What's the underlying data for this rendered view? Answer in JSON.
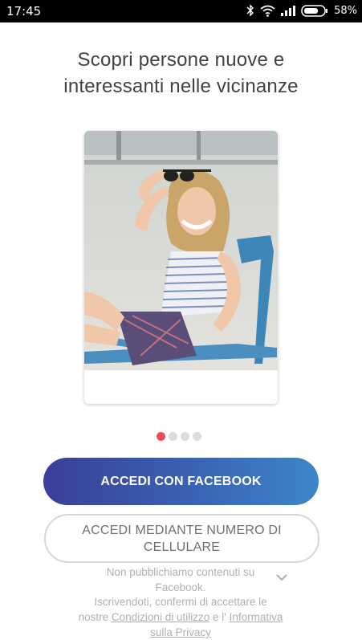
{
  "status_bar": {
    "time": "17:45",
    "battery_percent": "58%",
    "icons": [
      "bluetooth-icon",
      "wifi-icon",
      "signal-icon",
      "battery-icon"
    ]
  },
  "onboarding": {
    "headline_line1": "Scopri persone nuove e",
    "headline_line2": "interessanti nelle vicinanze",
    "carousel": {
      "slide_count": 4,
      "active_index": 0
    }
  },
  "actions": {
    "facebook_label": "ACCEDI CON FACEBOOK",
    "phone_label_line1": "ACCEDI MEDIANTE NUMERO DI",
    "phone_label_line2": "CELLULARE"
  },
  "footer": {
    "disclaimer_line1": "Non pubblichiamo contenuti su",
    "disclaimer_line2": "Facebook.",
    "legal_line1": "Iscrivendoti, confermi di accettare le",
    "legal_prefix": "nostre",
    "terms_link": "Condizioni di utilizzo",
    "legal_and": "e l'",
    "privacy_link_line1": "Informativa",
    "privacy_link_line2": "sulla Privacy"
  },
  "colors": {
    "accent": "#ea4d57",
    "facebook_gradient_start": "#3a3f96",
    "facebook_gradient_end": "#3e86c8"
  }
}
